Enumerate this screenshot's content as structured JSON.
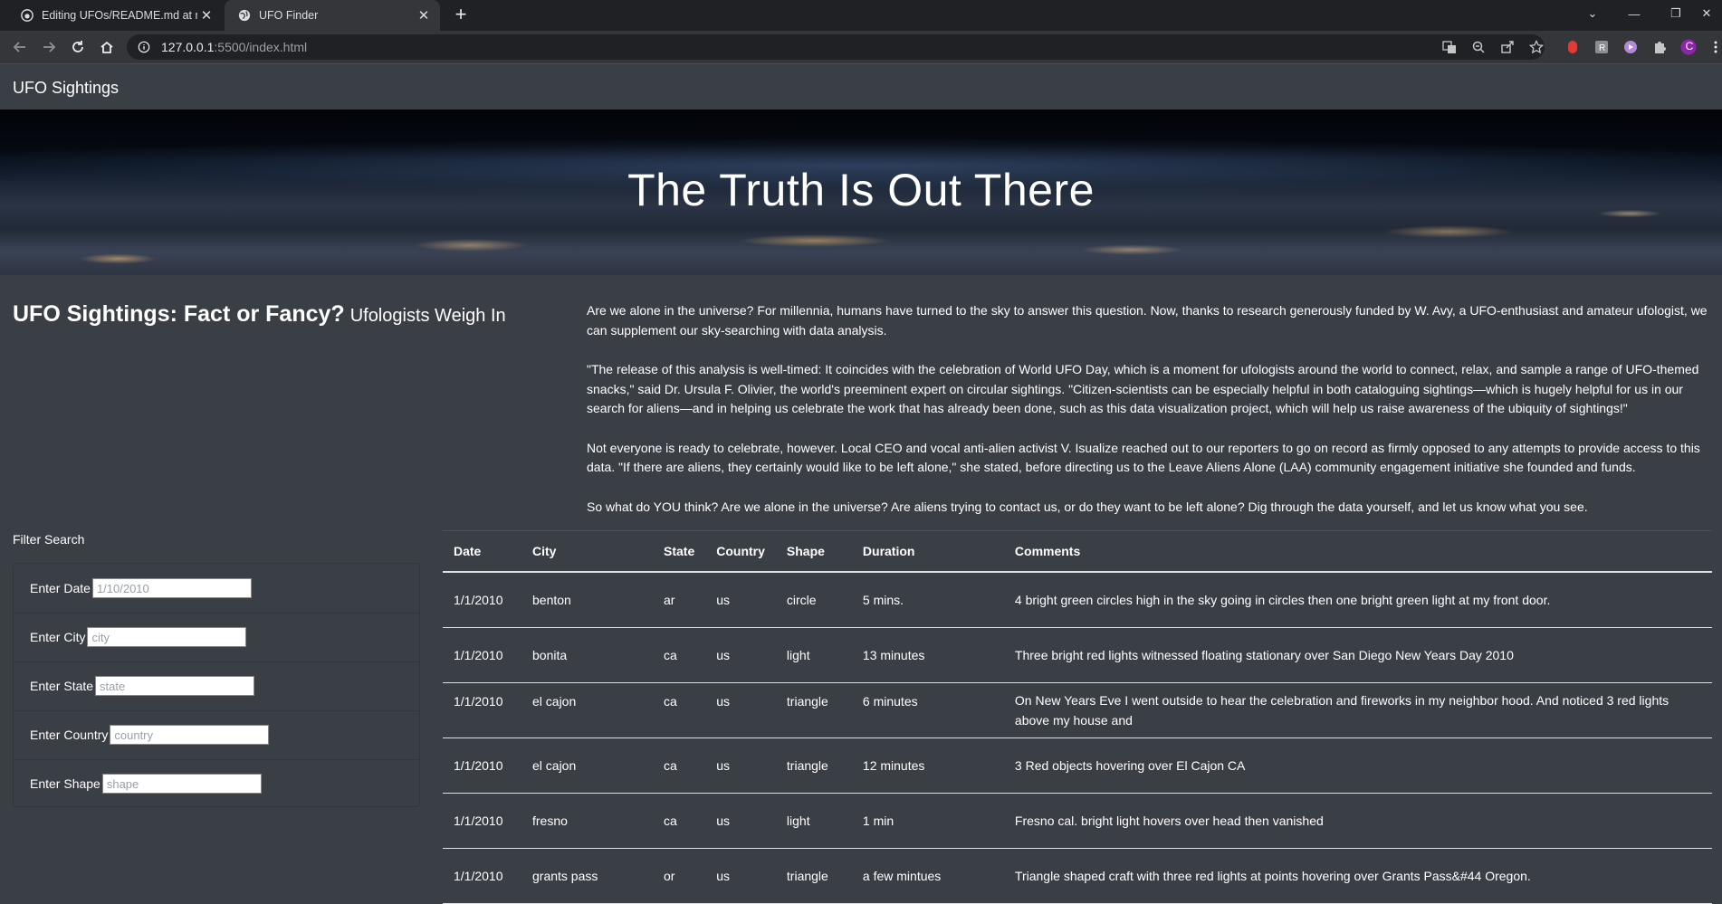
{
  "browser": {
    "tabs": [
      {
        "title": "Editing UFOs/README.md at ma",
        "active": false
      },
      {
        "title": "UFO Finder",
        "active": true
      }
    ],
    "url_host": "127.0.0.1",
    "url_rest": ":5500/index.html",
    "profile_initial": "C"
  },
  "page": {
    "brand": "UFO Sightings",
    "hero_title": "The Truth Is Out There",
    "article_title": "UFO Sightings: Fact or Fancy?",
    "article_subtitle": "Ufologists Weigh In",
    "paragraphs": [
      "Are we alone in the universe? For millennia, humans have turned to the sky to answer this question. Now, thanks to research generously funded by W. Avy, a UFO-enthusiast and amateur ufologist, we can supplement our sky-searching with data analysis.",
      "\"The release of this analysis is well-timed: It coincides with the celebration of World UFO Day, which is a moment for ufologists around the world to connect, relax, and sample a range of UFO-themed snacks,\" said Dr. Ursula F. Olivier, the world's preeminent expert on circular sightings. \"Citizen-scientists can be especially helpful in both cataloguing sightings—which is hugely helpful for us in our search for aliens—and in helping us celebrate the work that has already been done, such as this data visualization project, which will help us raise awareness of the ubiquity of sightings!\"",
      "Not everyone is ready to celebrate, however. Local CEO and vocal anti-alien activist V. Isualize reached out to our reporters to go on record as firmly opposed to any attempts to provide access to this data. \"If there are aliens, they certainly would like to be left alone,\" she stated, before directing us to the Leave Aliens Alone (LAA) community engagement initiative she founded and funds.",
      "So what do YOU think? Are we alone in the universe? Are aliens trying to contact us, or do they want to be left alone? Dig through the data yourself, and let us know what you see."
    ]
  },
  "filters": {
    "heading": "Filter Search",
    "date_label": "Enter Date",
    "date_placeholder": "1/10/2010",
    "city_label": "Enter City",
    "city_placeholder": "city",
    "state_label": "Enter State",
    "state_placeholder": "state",
    "country_label": "Enter Country",
    "country_placeholder": "country",
    "shape_label": "Enter Shape",
    "shape_placeholder": "shape"
  },
  "table": {
    "headers": [
      "Date",
      "City",
      "State",
      "Country",
      "Shape",
      "Duration",
      "Comments"
    ],
    "rows": [
      [
        "1/1/2010",
        "benton",
        "ar",
        "us",
        "circle",
        "5 mins.",
        "4 bright green circles high in the sky going in circles then one bright green light at my front door."
      ],
      [
        "1/1/2010",
        "bonita",
        "ca",
        "us",
        "light",
        "13 minutes",
        "Three bright red lights witnessed floating stationary over San Diego New Years Day 2010"
      ],
      [
        "1/1/2010",
        "el cajon",
        "ca",
        "us",
        "triangle",
        "6 minutes",
        "On New Years Eve I went outside to hear the celebration and fireworks in my neighbor hood. And noticed 3 red lights above my house and"
      ],
      [
        "1/1/2010",
        "el cajon",
        "ca",
        "us",
        "triangle",
        "12 minutes",
        "3 Red objects hovering over El Cajon CA"
      ],
      [
        "1/1/2010",
        "fresno",
        "ca",
        "us",
        "light",
        "1 min",
        "Fresno cal. bright light hovers over head then vanished"
      ],
      [
        "1/1/2010",
        "grants pass",
        "or",
        "us",
        "triangle",
        "a few mintues",
        "Triangle shaped craft with three red lights at points hovering over Grants Pass&#44 Oregon."
      ]
    ]
  }
}
